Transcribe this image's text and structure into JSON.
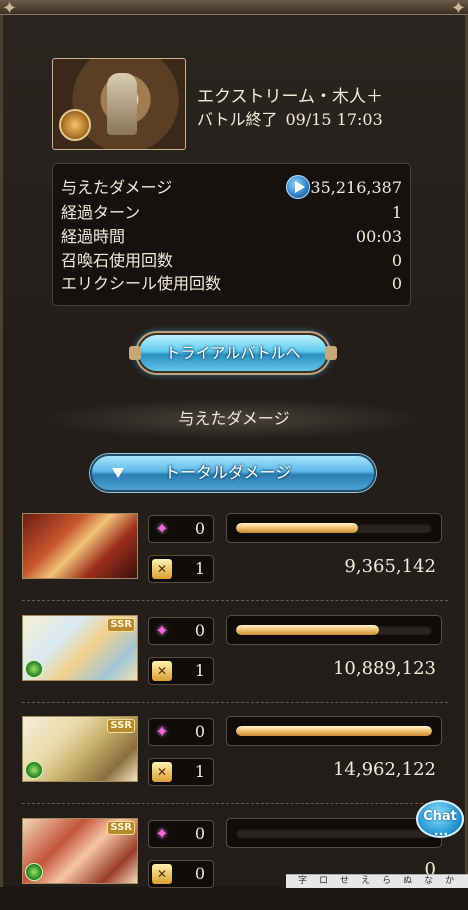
{
  "quest": {
    "title": "エクストリーム・木人＋",
    "status": "バトル終了",
    "datetime": "09/15 17:03"
  },
  "stats": [
    {
      "label": "与えたダメージ",
      "value": "35,216,387"
    },
    {
      "label": "経過ターン",
      "value": "1"
    },
    {
      "label": "経過時間",
      "value": "00:03"
    },
    {
      "label": "召喚石使用回数",
      "value": "0"
    },
    {
      "label": "エリクシール使用回数",
      "value": "0"
    }
  ],
  "trial_button": {
    "label": "トライアルバトルへ"
  },
  "damage_section": {
    "title": "与えたダメージ"
  },
  "total_dropdown": {
    "label": "トータルダメージ"
  },
  "characters": [
    {
      "portrait": "twin-knights-portrait",
      "rarity": "",
      "special_count": "0",
      "ability_count": "1",
      "damage": "9,365,142",
      "bar_fill": 0.62
    },
    {
      "portrait": "elf-girl-portrait",
      "rarity": "SSR",
      "special_count": "0",
      "ability_count": "1",
      "damage": "10,889,123",
      "bar_fill": 0.73
    },
    {
      "portrait": "blonde-knight-portrait",
      "rarity": "SSR",
      "special_count": "0",
      "ability_count": "1",
      "damage": "14,962,122",
      "bar_fill": 1.0
    },
    {
      "portrait": "red-haired-portrait",
      "rarity": "SSR",
      "special_count": "0",
      "ability_count": "0",
      "damage": "0",
      "bar_fill": 0.0
    }
  ],
  "chat": {
    "label": "Chat",
    "dots": "•••"
  },
  "toolbar": {
    "items": [
      "字",
      "ロ",
      "せ",
      "え",
      "ら",
      "ぬ",
      "な",
      "か"
    ]
  },
  "icons": {
    "special": "sparkle-icon",
    "ability": "ability-icon",
    "play": "play-icon",
    "element": "wind-element-icon"
  },
  "colors": {
    "accent_blue": "#5ecbee",
    "gold_bar": "#f0c070",
    "background": "#231e1a"
  }
}
